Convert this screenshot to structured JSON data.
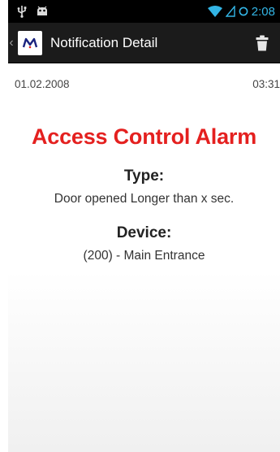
{
  "statusbar": {
    "time": "2:08"
  },
  "actionbar": {
    "title": "Notification Detail",
    "icon_letter": "M"
  },
  "notification": {
    "date": "01.02.2008",
    "time": "03:31",
    "title": "Access Control Alarm",
    "type_label": "Type:",
    "type_value": "Door opened Longer than x sec.",
    "device_label": "Device:",
    "device_value": "(200) - Main Entrance"
  },
  "colors": {
    "alarm": "#e4201f",
    "accent": "#33b5e5",
    "actionbar": "#1b1b1b"
  }
}
